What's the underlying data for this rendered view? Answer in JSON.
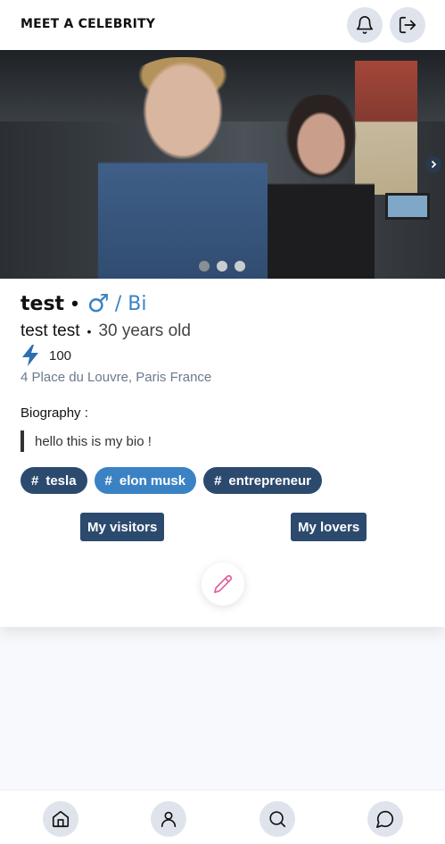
{
  "app": {
    "title": "MEET A CELEBRITY"
  },
  "header": {
    "notifications_icon": "bell-icon",
    "logout_icon": "logout-icon"
  },
  "gallery": {
    "photo_count": 3,
    "active_index": 1,
    "next_icon": "chevron-right-icon"
  },
  "profile": {
    "username": "test",
    "gender_symbol": "♂",
    "orientation": "/ Bi",
    "full_name": "test test",
    "age": "30 years old",
    "score": "100",
    "location": "4 Place du Louvre, Paris France",
    "bio_label": "Biography :",
    "bio": "hello this is my bio !",
    "tags": [
      {
        "hash": "#",
        "label": "tesla",
        "highlighted": false
      },
      {
        "hash": "#",
        "label": "elon musk",
        "highlighted": true
      },
      {
        "hash": "#",
        "label": "entrepreneur",
        "highlighted": false
      }
    ],
    "visitors_button": "My visitors",
    "lovers_button": "My lovers"
  },
  "colors": {
    "accent": "#3b82c4",
    "dark_button": "#2c4a6e",
    "edit_icon": "#e0609a",
    "background": "#f7f9fc"
  },
  "bottom_nav": [
    "home-icon",
    "user-icon",
    "search-icon",
    "chat-icon"
  ]
}
